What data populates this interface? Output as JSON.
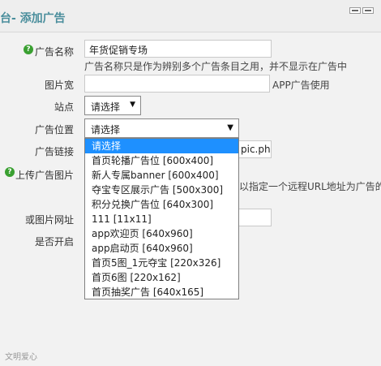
{
  "header": {
    "title": "台- 添加广告"
  },
  "form": {
    "ad_name": {
      "label": "广告名称",
      "value": "年货促销专场",
      "hint": "广告名称只是作为辨别多个广告条目之用，并不显示在广告中"
    },
    "image_width": {
      "label": "图片宽",
      "value": "",
      "hint": "APP广告使用"
    },
    "site": {
      "label": "站点",
      "selected": "请选择"
    },
    "ad_position": {
      "label": "广告位置",
      "selected": "请选择",
      "options": [
        "请选择",
        "首页轮播广告位 [600x400]",
        "新人专属banner [600x400]",
        "夺宝专区展示广告 [500x300]",
        "积分兑换广告位 [640x300]",
        "111 [11x11]",
        "app欢迎页 [640x960]",
        "app启动页 [640x960]",
        "首页5图_1元夺宝 [220x326]",
        "首页6图 [220x162]",
        "首页抽奖广告 [640x165]"
      ]
    },
    "ad_link": {
      "label": "广告链接",
      "value_fragment": "pic.php"
    },
    "upload_image": {
      "label": "上传广告图片",
      "hint": "以指定一个远程URL地址为广告的"
    },
    "image_url": {
      "label": "或图片网址",
      "value": ""
    },
    "enabled": {
      "label": "是否开启"
    }
  },
  "watermark": "文明爱心"
}
